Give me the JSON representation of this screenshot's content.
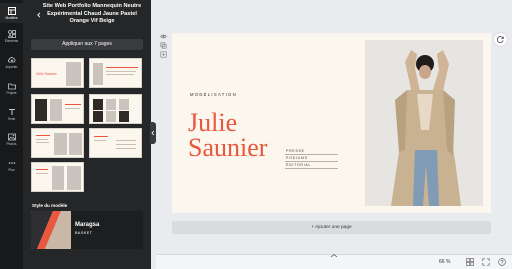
{
  "rail": {
    "items": [
      {
        "label": "Modèles",
        "icon": "template-icon"
      },
      {
        "label": "Éléments",
        "icon": "elements-icon"
      },
      {
        "label": "Importer",
        "icon": "upload-icon"
      },
      {
        "label": "Projets",
        "icon": "folder-icon"
      },
      {
        "label": "Texte",
        "icon": "text-icon"
      },
      {
        "label": "Photos",
        "icon": "photo-icon"
      },
      {
        "label": "Plus",
        "icon": "more-icon"
      }
    ]
  },
  "panel": {
    "title": "Site Web Portfolio Mannequin Neutre Expérimental Chaud Jaune Pastel Orange Vif Beige",
    "apply_button": "Appliquer aux 7 pages",
    "thumb_title": "Julie Saunier",
    "style_section": "Style du modèle",
    "style_name": "Maragsa",
    "style_font": "BASKET"
  },
  "page": {
    "eyebrow": "MODÉLISATION",
    "name_line1": "Julie",
    "name_line2": "Saunier",
    "menu": [
      "PRESSE",
      "PODIUMS",
      "ÉDITORIAL"
    ]
  },
  "canvas": {
    "add_page": "+ Ajouter une page",
    "zoom": "66 %"
  },
  "colors": {
    "accent": "#e8573e",
    "page_bg": "#fbf6ee",
    "panel_bg": "#252627",
    "rail_bg": "#18191b"
  }
}
